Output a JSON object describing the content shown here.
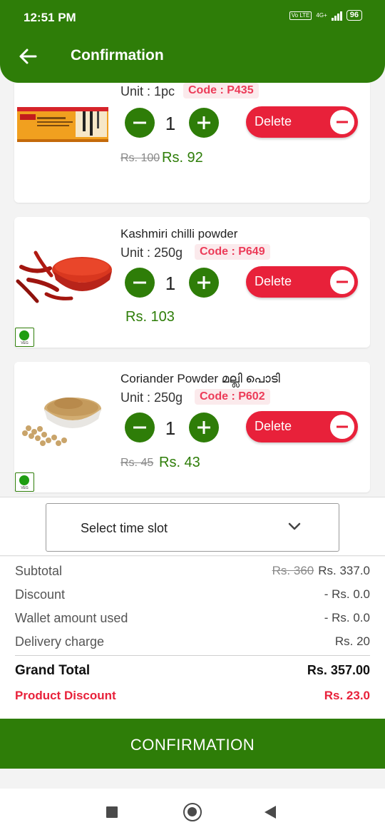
{
  "status_bar": {
    "time": "12:51 PM",
    "network": "4G+",
    "volte": "Vo LTE",
    "battery": "96"
  },
  "header": {
    "title": "Confirmation",
    "back_icon": "arrow-left-icon"
  },
  "colors": {
    "primary_green": "#2e7d08",
    "delete_red": "#e8213a",
    "code_pink": "#ec3b58"
  },
  "products": [
    {
      "name": "",
      "unit": "Unit : 1pc",
      "code": "Code : P435",
      "quantity": "1",
      "price_old": "Rs. 100",
      "price_new": "Rs. 92",
      "delete_label": "Delete",
      "veg": false,
      "image": "scholar-box-image"
    },
    {
      "name": "Kashmiri chilli powder",
      "unit": "Unit : 250g",
      "code": "Code : P649",
      "quantity": "1",
      "price_old": "",
      "price_new": "Rs. 103",
      "delete_label": "Delete",
      "veg": true,
      "veg_text": "VEG",
      "image": "chilli-powder-image"
    },
    {
      "name": "Coriander Powder മല്ലി പൊടി",
      "unit": "Unit : 250g",
      "code": "Code : P602",
      "quantity": "1",
      "price_old": "Rs. 45",
      "price_new": "Rs. 43",
      "delete_label": "Delete",
      "veg": true,
      "veg_text": "VEG",
      "image": "coriander-powder-image"
    }
  ],
  "time_slot": {
    "label": "Select time slot"
  },
  "summary": {
    "subtotal_label": "Subtotal",
    "subtotal_old": "Rs. 360",
    "subtotal_value": "Rs. 337.0",
    "discount_label": "Discount",
    "discount_value": "- Rs. 0.0",
    "wallet_label": "Wallet amount used",
    "wallet_value": "- Rs. 0.0",
    "delivery_label": "Delivery charge",
    "delivery_value": "Rs. 20",
    "grand_total_label": "Grand Total",
    "grand_total_value": "Rs. 357.00",
    "product_discount_label": "Product Discount",
    "product_discount_value": "Rs. 23.0"
  },
  "confirm_button": {
    "label": "CONFIRMATION"
  }
}
